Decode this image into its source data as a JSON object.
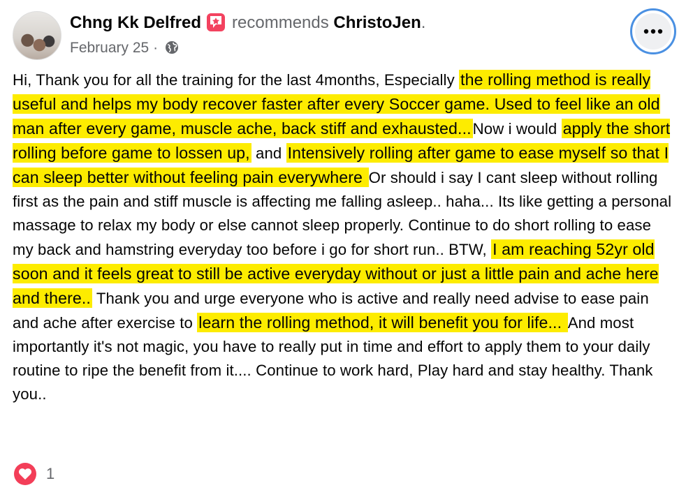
{
  "post": {
    "author": "Chng Kk Delfred",
    "recommends_text": "recommends",
    "page_name": "ChristoJen",
    "period": ".",
    "date": "February 25",
    "separator": "·",
    "more_button_label": "•••",
    "body_segments": [
      {
        "text": "Hi, Thank you for all the training for the last 4months, Especially ",
        "highlight": false
      },
      {
        "text": "the rolling method is really useful and helps my body recover faster after every Soccer game. Used to feel like an old man after every game, muscle ache, back stiff and exhausted...",
        "highlight": true
      },
      {
        "text": "Now i would ",
        "highlight": false
      },
      {
        "text": "apply the short rolling before game to lossen up,",
        "highlight": true
      },
      {
        "text": " and ",
        "highlight": false
      },
      {
        "text": "Intensively rolling after game to ease myself so that I can sleep better without feeling pain everywhere ",
        "highlight": true
      },
      {
        "text": " Or should i say I cant sleep without rolling first as the pain and stiff muscle is affecting me falling asleep.. haha... Its like getting a personal massage to relax my body or else cannot sleep properly. Continue to do short rolling to ease my back and hamstring everyday too before i go for short run.. BTW, ",
        "highlight": false
      },
      {
        "text": "I am reaching 52yr old soon and it feels great to still be active everyday without or just a little pain and ache here and there..",
        "highlight": true
      },
      {
        "text": " Thank you and urge everyone who is active and really need advise to ease pain and ache after exercise to ",
        "highlight": false
      },
      {
        "text": "learn the rolling method, it will benefit you for life... ",
        "highlight": true
      },
      {
        "text": " And most importantly it's not magic, you have to really put in time and effort to apply them to your daily routine to ripe the benefit from it.... Continue to work hard, Play hard and stay healthy. Thank you..",
        "highlight": false
      }
    ],
    "reaction_icon": "love-heart-icon",
    "reaction_count": "1"
  },
  "colors": {
    "highlight": "#fdec00",
    "secondary_text": "#65676b",
    "recommend_badge": "#f3425f",
    "love_reaction": "#f33e58",
    "focus_ring": "#4a90e2"
  }
}
